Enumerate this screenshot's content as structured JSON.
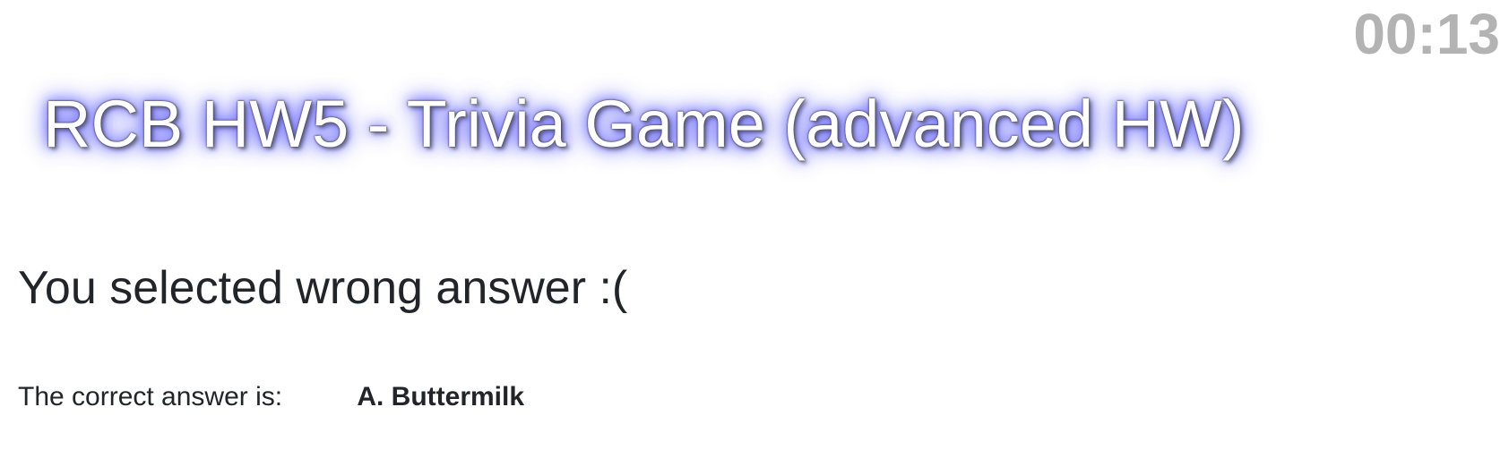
{
  "timer": "00:13",
  "title": "RCB HW5 - Trivia Game (advanced HW)",
  "result": {
    "heading": "You selected wrong answer :(",
    "correct_label": "The correct answer is:",
    "correct_answer": "A. Buttermilk"
  },
  "colors": {
    "timer": "#b3b3b3",
    "title_text": "#ffffff",
    "title_glow": "#6b6bff",
    "body_text": "#212529"
  }
}
